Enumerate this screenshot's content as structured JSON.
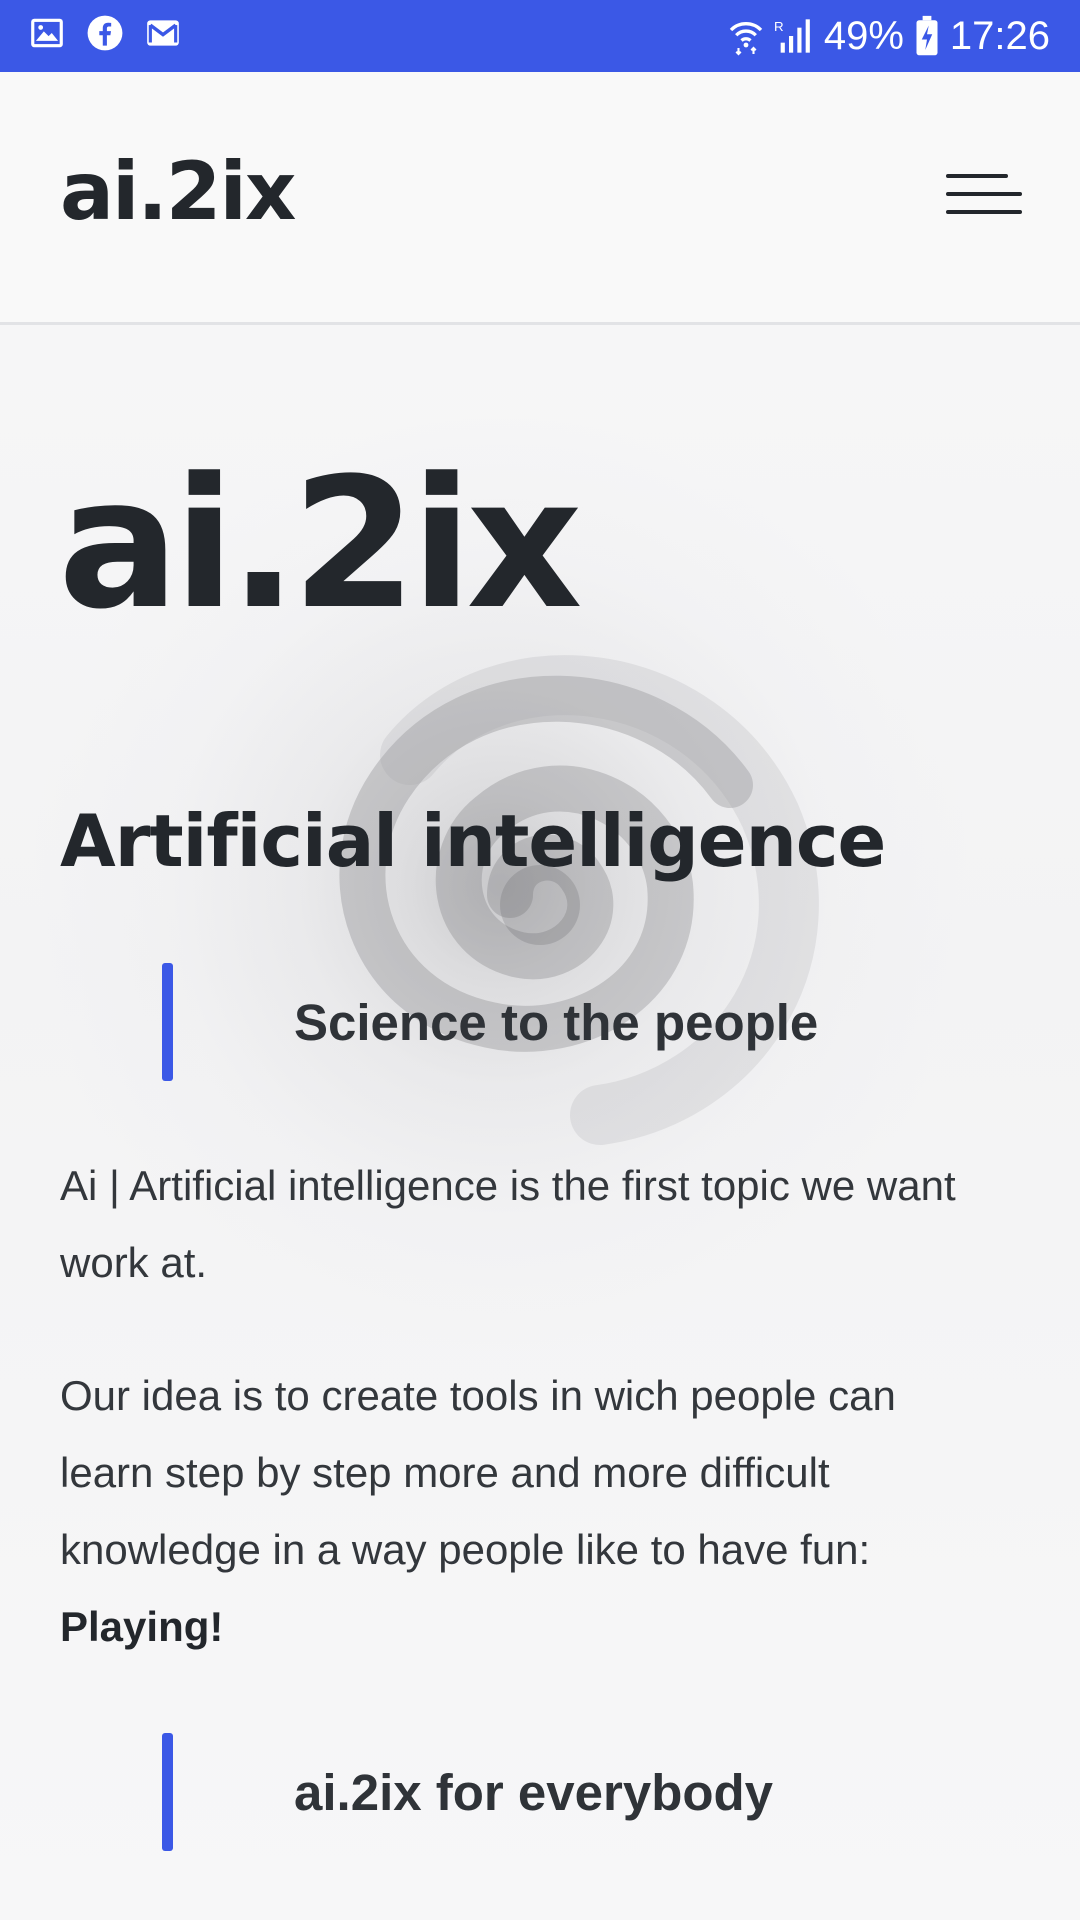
{
  "status_bar": {
    "icons_left": [
      "image-icon",
      "facebook-icon",
      "gmail-icon"
    ],
    "battery": "49%",
    "time": "17:26"
  },
  "header": {
    "brand": "ai.2ix",
    "menu_icon": "hamburger-menu-icon"
  },
  "hero": {
    "title": "ai.2ix",
    "section_heading": "Artificial intelligence",
    "quote_1": "Science to the people",
    "paragraph_1": "Ai | Artificial intelligence is the first topic we want work at.",
    "paragraph_2": "Our idea is to create tools in wich people can learn step by step more and more difficult knowledge in a way people like to have fun:",
    "paragraph_2_emphasis": "Playing!",
    "quote_2": "ai.2ix for everybody"
  },
  "colors": {
    "accent": "#3b58e6",
    "text": "#23272c",
    "background": "#f7f7f8"
  }
}
